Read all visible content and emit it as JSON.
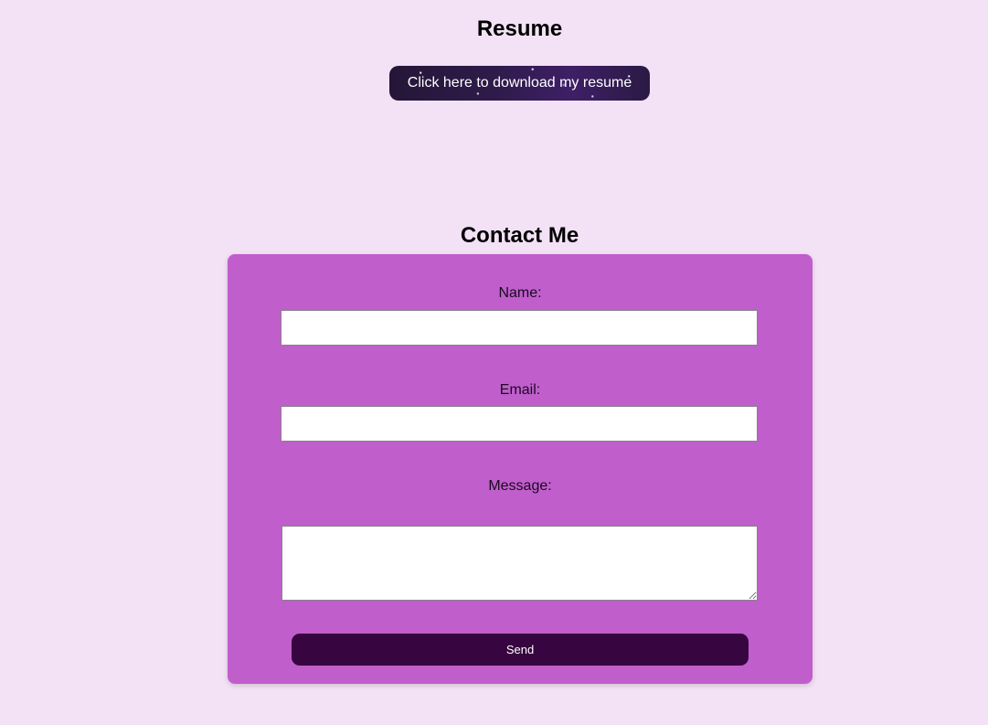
{
  "resume": {
    "title": "Resume",
    "download_label": "Click here to download my resume"
  },
  "contact": {
    "title": "Contact Me",
    "name_label": "Name:",
    "name_value": "",
    "email_label": "Email:",
    "email_value": "",
    "message_label": "Message:",
    "message_value": "",
    "send_label": "Send"
  },
  "colors": {
    "page_background": "#f3e1f5",
    "card_background": "#c05ecc",
    "send_button": "#37053f",
    "resume_button": "#2e1b4a"
  }
}
